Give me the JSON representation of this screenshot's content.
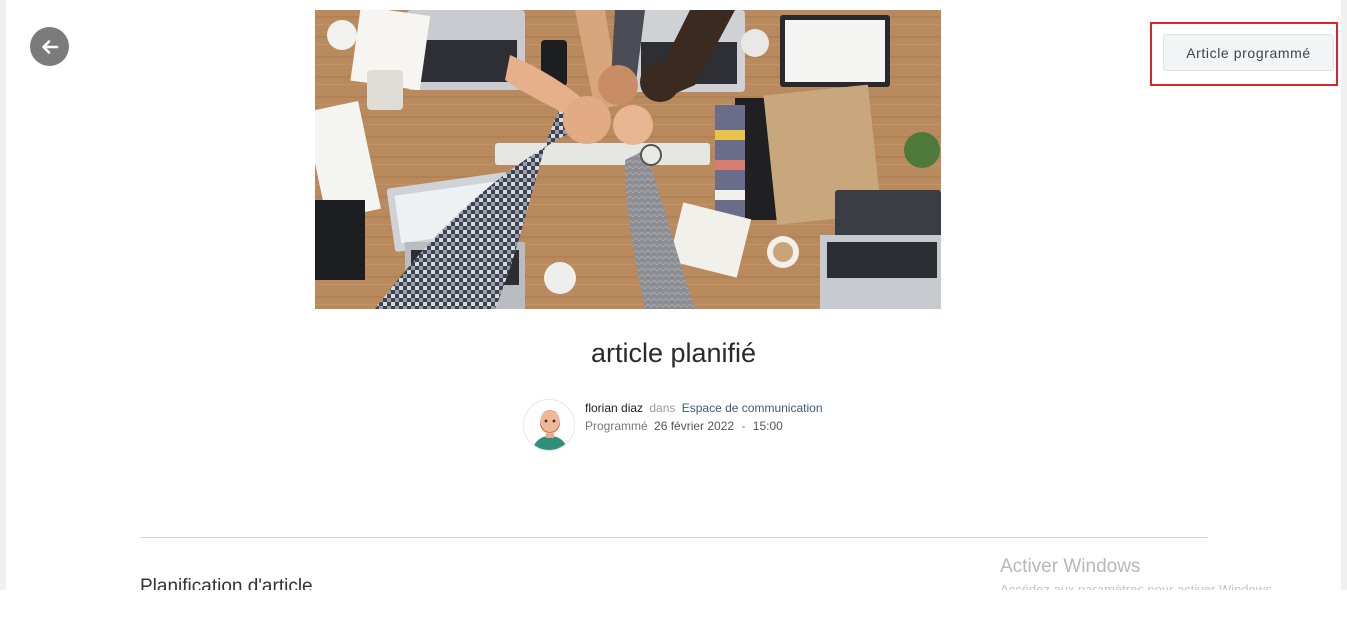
{
  "header": {
    "status_button_label": "Article programmé"
  },
  "article": {
    "title": "article planifié",
    "author": "florian diaz",
    "in_word": "dans",
    "space": "Espace de communication",
    "schedule_label": "Programmé",
    "schedule_date": "26 février 2022",
    "separator": "-",
    "schedule_time": "15:00"
  },
  "content": {
    "section_heading": "Planification d'article"
  },
  "watermark": {
    "title": "Activer Windows",
    "subtitle": "Accédez aux paramètres pour activer Windows."
  },
  "icons": {
    "back": "arrow-left-icon",
    "avatar": "user-avatar-illustration"
  },
  "colors": {
    "highlight_border": "#d9262c",
    "back_button": "#7b7b7b",
    "link": "#3a5a80"
  }
}
